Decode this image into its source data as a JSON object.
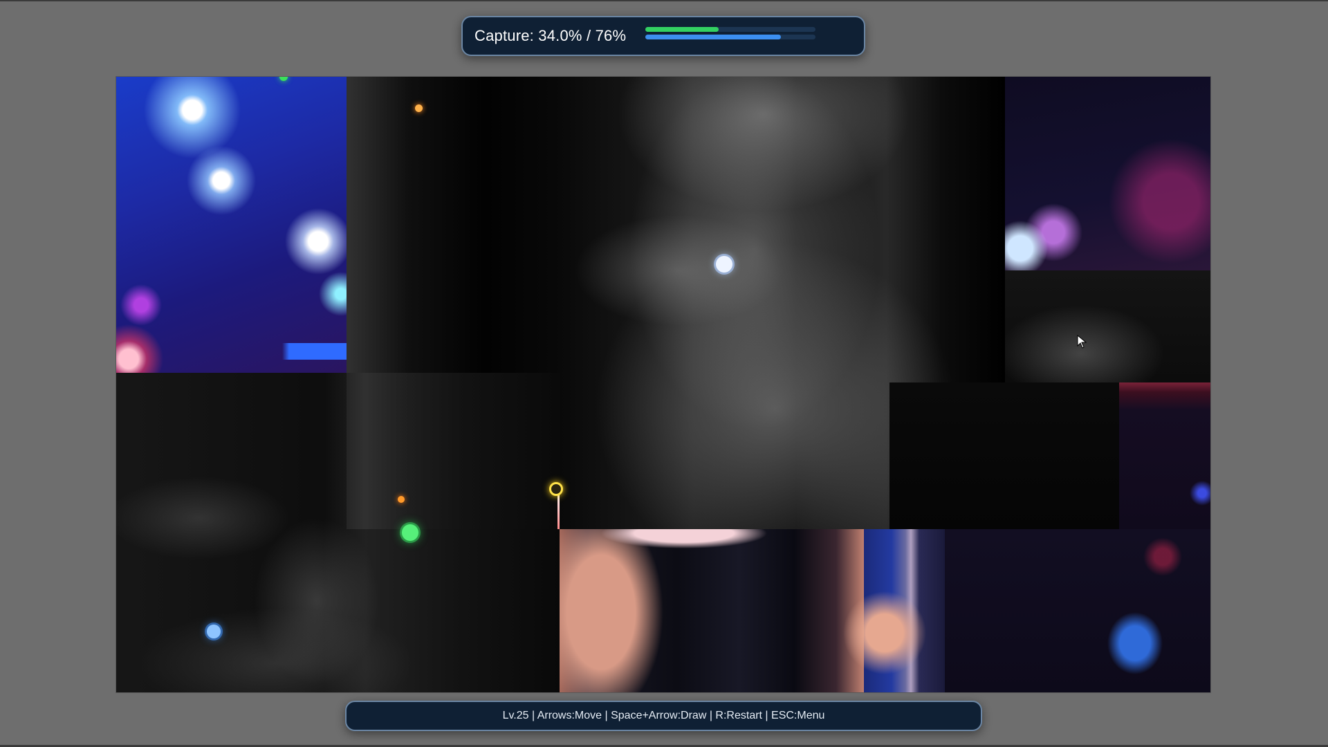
{
  "hud": {
    "capture_label": "Capture: 34.0% / 76%",
    "capture_percent": 34.0,
    "target_percent": 76,
    "progress_color": "#33d162",
    "target_color": "#3c8ff0"
  },
  "help": {
    "text": "Lv.25 | Arrows:Move | Space+Arrow:Draw | R:Restart | ESC:Menu"
  },
  "colors": {
    "panel_bg": "#0f2034",
    "panel_border": "#6b86a4",
    "page_bg": "#6e6e6e"
  },
  "icons": {
    "player": "player-marker-icon",
    "cursor": "mouse-cursor-icon"
  }
}
